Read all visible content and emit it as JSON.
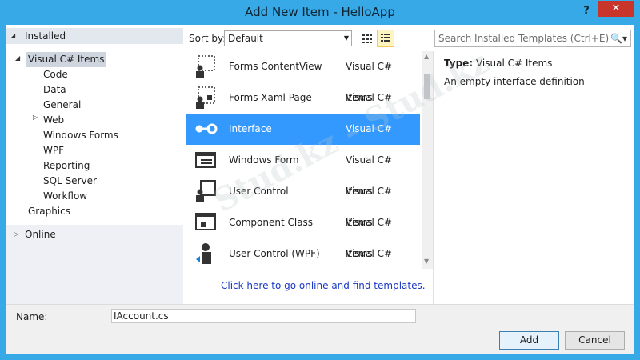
{
  "window": {
    "title": "Add New Item - HelloApp",
    "help_label": "?",
    "close_label": "✕"
  },
  "tree": {
    "installed_label": "Installed",
    "root_label": "Visual C# Items",
    "children": [
      "Code",
      "Data",
      "General",
      "Web",
      "Windows Forms",
      "WPF",
      "Reporting",
      "SQL Server",
      "Workflow"
    ],
    "graphics_label": "Graphics",
    "online_label": "Online"
  },
  "toolbar": {
    "sort_label": "Sort by:",
    "sort_value": "Default",
    "search_placeholder": "Search Installed Templates (Ctrl+E)"
  },
  "templates": [
    {
      "name": "Forms ContentView",
      "category": "Visual C# Items",
      "icon": "forms-contentview-icon"
    },
    {
      "name": "Forms Xaml Page",
      "category": "Visual C# Items",
      "icon": "forms-xaml-page-icon"
    },
    {
      "name": "Interface",
      "category": "Visual C# Items",
      "icon": "interface-icon"
    },
    {
      "name": "Windows Form",
      "category": "Visual C# Items",
      "icon": "windows-form-icon"
    },
    {
      "name": "User Control",
      "category": "Visual C# Items",
      "icon": "user-control-icon"
    },
    {
      "name": "Component Class",
      "category": "Visual C# Items",
      "icon": "component-class-icon"
    },
    {
      "name": "User Control (WPF)",
      "category": "Visual C# Items",
      "icon": "user-control-wpf-icon"
    }
  ],
  "online_link": "Click here to go online and find templates.",
  "details": {
    "type_label": "Type:",
    "type_value": "Visual C# Items",
    "description": "An empty interface definition"
  },
  "form": {
    "name_label": "Name:",
    "name_value": "IAccount.cs",
    "add_label": "Add",
    "cancel_label": "Cancel"
  },
  "watermark": "Stud.kz - Stud.kz",
  "colors": {
    "title_bar": "#36a9e6",
    "close_button": "#c7352b",
    "selection": "#3399ff",
    "link": "#1a39c4"
  }
}
